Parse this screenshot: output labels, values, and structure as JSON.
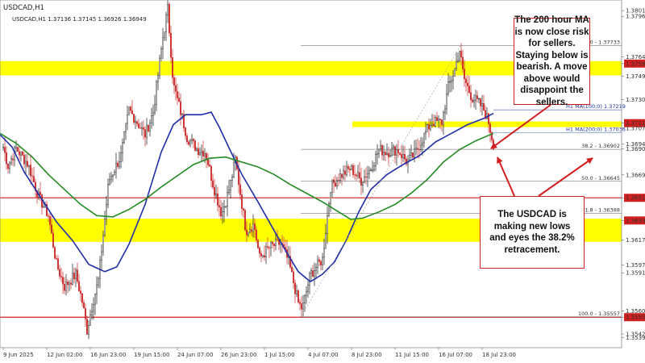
{
  "header": {
    "symbol": "USDCAD,H1",
    "ohlc_line": "USDCAD,H1  1.37136 1.37145 1.36926 1.36949"
  },
  "annotations": {
    "top_note": "The 200 hour MA is now close risk for sellers. Staying below is bearish. A move above would disappoint the sellers.",
    "bottom_note": "The USDCAD is making new lows and eyes the 38.2% retracement."
  },
  "colors": {
    "highlight_band": "#ffff00",
    "support_line": "#d21f1f",
    "ma100": "#1f2fa8",
    "ma200": "#228b22",
    "candle_up": "#1a1a1a",
    "candle_down": "#cc2b2b",
    "arrow": "#d21f1f"
  },
  "chart_data": {
    "type": "candlestick",
    "title": "USDCAD,H1",
    "ylim": [
      1.3533,
      1.381
    ],
    "price_tick_labels": [
      "1.38015",
      "1.37969",
      "1.37645",
      "1.37590",
      "1.37490",
      "1.37301",
      "1.37112",
      "1.37072",
      "1.36944",
      "1.36905",
      "1.36697",
      "1.36513",
      "1.36331",
      "1.36173",
      "1.35975",
      "1.35911",
      "1.35605",
      "1.35555",
      "1.35420",
      "1.35390"
    ],
    "time_tick_labels": [
      "9 Jun 2025",
      "12 Jun 02:00",
      "16 Jun 23:00",
      "19 Jun 15:00",
      "24 Jun 07:00",
      "26 Jun 23:00",
      "1 Jul 15:00",
      "4 Jul 07:00",
      "8 Jul 23:00",
      "11 Jul 15:00",
      "16 Jul 07:00",
      "18 Jul 23:00"
    ],
    "highlighted_levels": [
      {
        "price": 1.3759,
        "label": "1.37590",
        "band": [
          1.37495,
          1.3761
        ]
      },
      {
        "price": 1.37112,
        "label": "1.37112",
        "band": [
          1.3708,
          1.37125
        ]
      },
      {
        "price": 1.36331,
        "label": "1.36331",
        "band": [
          1.3616,
          1.36345
        ]
      }
    ],
    "support_lines": [
      1.36513,
      1.35555
    ],
    "fibonacci": {
      "swing_low": 1.35557,
      "swing_high": 1.37733,
      "levels": [
        {
          "ratio": "0.0",
          "price": 1.37733,
          "label": "0.0 - 1.37733"
        },
        {
          "ratio": "38.2",
          "price": 1.36902,
          "label": "38.2 - 1.36902"
        },
        {
          "ratio": "50.0",
          "price": 1.36645,
          "label": "50.0 - 1.36645"
        },
        {
          "ratio": "61.8",
          "price": 1.36388,
          "label": "61.8 - 1.36388"
        },
        {
          "ratio": "100.0",
          "price": 1.35557,
          "label": "100.0 - 1.35557"
        }
      ]
    },
    "moving_averages": [
      {
        "name": "H1 MA(100;0) 1.37219",
        "period": 100,
        "value": 1.37219
      },
      {
        "name": "H1 MA(200;0) 1.37036",
        "period": 200,
        "value": 1.37036
      }
    ],
    "last_close": 1.36949
  }
}
